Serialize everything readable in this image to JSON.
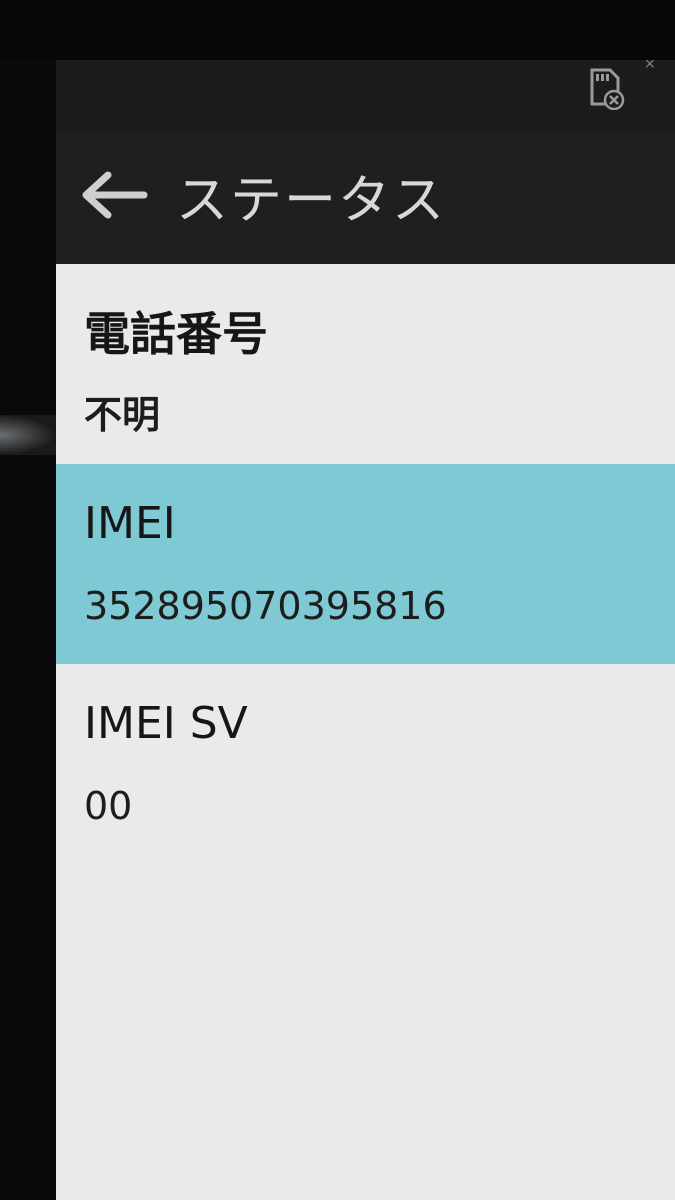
{
  "statusbar": {
    "close_glyph": "×",
    "sd_icon": "sd-card-error-icon"
  },
  "actionbar": {
    "back_icon": "arrow-left-icon",
    "title": "ステータス"
  },
  "items": [
    {
      "title": "電話番号",
      "value": "不明",
      "selected": false
    },
    {
      "title": "IMEI",
      "value": "352895070395816",
      "selected": true
    },
    {
      "title": "IMEI SV",
      "value": "00",
      "selected": false
    }
  ],
  "colors": {
    "statusbar_bg": "#1c1c1c",
    "actionbar_bg": "#1f1f1f",
    "list_bg": "#e9eaea",
    "selected_bg": "#7fc9d4"
  }
}
